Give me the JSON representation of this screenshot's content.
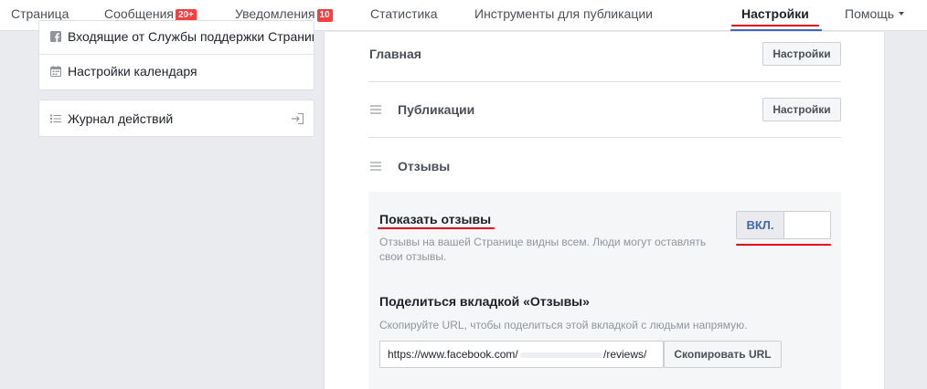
{
  "nav": {
    "page": "Страница",
    "messages": "Сообщения",
    "messages_badge": "20+",
    "notifications": "Уведомления",
    "notifications_badge": "10",
    "stats": "Статистика",
    "publishing_tools": "Инструменты для публикации",
    "settings": "Настройки",
    "help": "Помощь"
  },
  "sidebar": {
    "support_inbox": "Входящие от Службы поддержки Страниц",
    "calendar_settings": "Настройки календаря",
    "activity_log": "Журнал действий"
  },
  "main": {
    "general": {
      "title": "Главная",
      "button": "Настройки"
    },
    "publications": {
      "title": "Публикации",
      "button": "Настройки"
    },
    "reviews": {
      "title": "Отзывы",
      "show_reviews": {
        "title": "Показать отзывы",
        "description": "Отзывы на вашей Странице видны всем. Люди могут оставлять свои отзывы.",
        "toggle_label": "ВКЛ."
      },
      "share_tab": {
        "title": "Поделиться вкладкой «Отзывы»",
        "description": "Скопируйте URL, чтобы поделиться этой вкладкой с людьми напрямую.",
        "url_prefix": "https://www.facebook.com/",
        "url_suffix": "/reviews/",
        "copy_button": "Скопировать URL"
      }
    }
  },
  "colors": {
    "accent": "#4267b2",
    "annotation_red": "#e3001b",
    "badge_red": "#fa3e3e"
  }
}
